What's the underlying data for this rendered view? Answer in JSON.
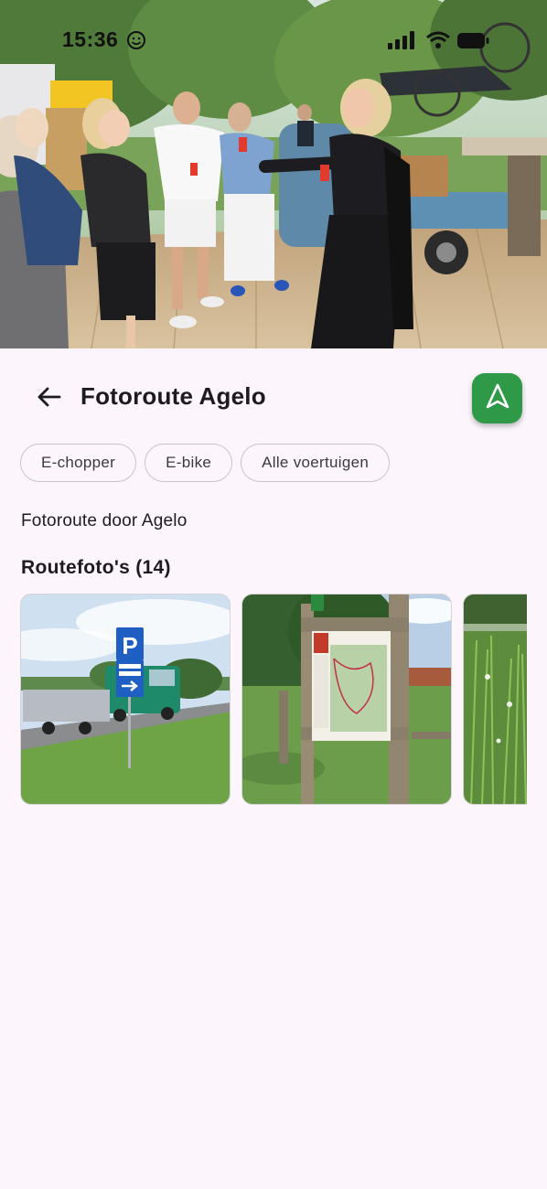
{
  "status_bar": {
    "time": "15:36"
  },
  "header": {
    "title": "Fotoroute Agelo",
    "back_icon": "arrow-left-icon",
    "navigate_icon": "navigation-arrow-icon"
  },
  "filters": [
    {
      "label": "E-chopper"
    },
    {
      "label": "E-bike"
    },
    {
      "label": "Alle voertuigen"
    }
  ],
  "description": "Fotoroute door Agelo",
  "photos_section": {
    "title": "Routefoto's (14)",
    "photos": [
      {
        "subject": "parking-sign-roadside"
      },
      {
        "subject": "route-map-information-board"
      },
      {
        "subject": "tall-grass-field"
      }
    ]
  },
  "colors": {
    "background": "#fcf6fc",
    "accent_green": "#2e9a48",
    "chip_border": "#c9c3cc"
  }
}
